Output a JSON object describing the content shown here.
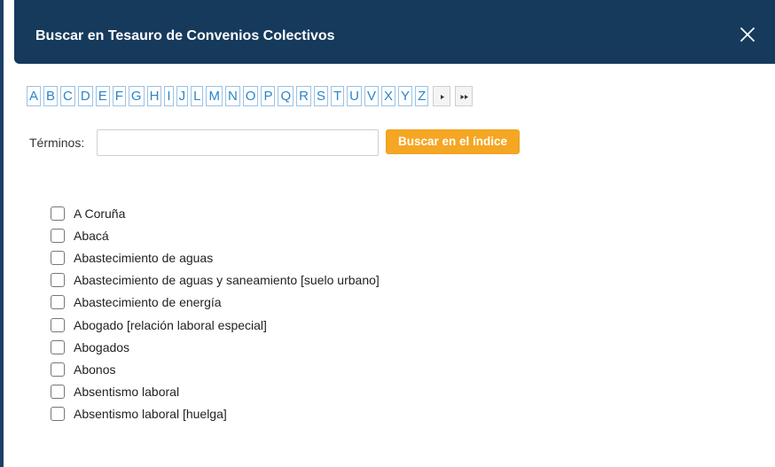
{
  "dialog": {
    "title": "Buscar en Tesauro de Convenios Colectivos",
    "close_icon": "close-icon"
  },
  "alphabet": {
    "letters": [
      "A",
      "B",
      "C",
      "D",
      "E",
      "F",
      "G",
      "H",
      "I",
      "J",
      "L",
      "M",
      "N",
      "O",
      "P",
      "Q",
      "R",
      "S",
      "T",
      "U",
      "V",
      "X",
      "Y",
      "Z"
    ],
    "nav_icons": [
      "next-page-icon",
      "last-page-icon"
    ]
  },
  "search": {
    "label": "Términos:",
    "value": "",
    "placeholder": "",
    "button_label": "Buscar en el índice",
    "button_color": "#f5a623"
  },
  "terms": [
    {
      "label": "A Coruña",
      "checked": false
    },
    {
      "label": "Abacá",
      "checked": false
    },
    {
      "label": "Abastecimiento de aguas",
      "checked": false
    },
    {
      "label": "Abastecimiento de aguas y saneamiento [suelo urbano]",
      "checked": false
    },
    {
      "label": "Abastecimiento de energía",
      "checked": false
    },
    {
      "label": "Abogado [relación laboral especial]",
      "checked": false
    },
    {
      "label": "Abogados",
      "checked": false
    },
    {
      "label": "Abonos",
      "checked": false
    },
    {
      "label": "Absentismo laboral",
      "checked": false
    },
    {
      "label": "Absentismo laboral [huelga]",
      "checked": false
    }
  ],
  "colors": {
    "header_bg": "#163a5c",
    "letter_link": "#2a84c8",
    "letter_border": "#9cc2e4"
  }
}
